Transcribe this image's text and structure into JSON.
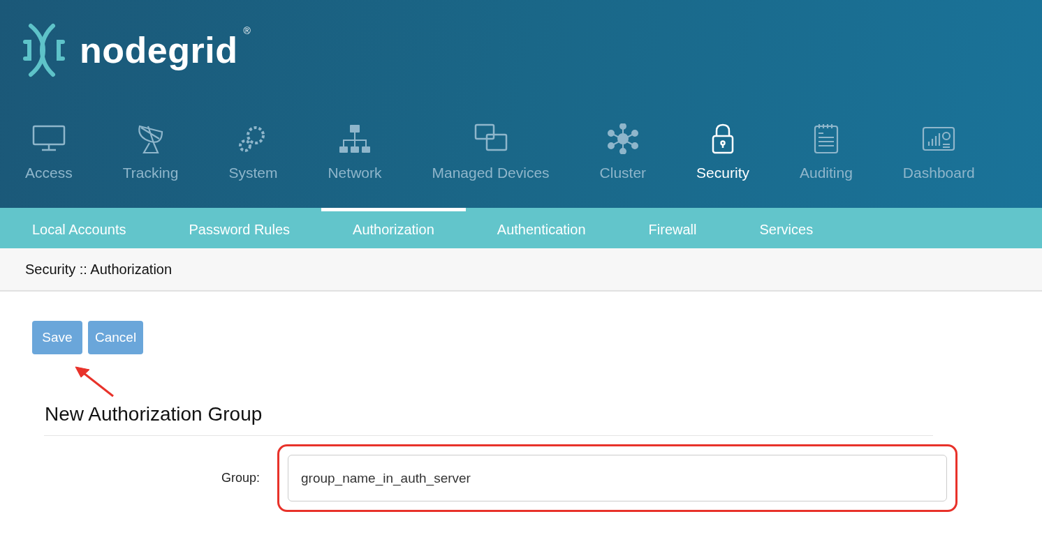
{
  "logo": {
    "wordmark": "nodegrid",
    "trademark": "®"
  },
  "main_nav": [
    {
      "label": "Access",
      "kind": "monitor",
      "selected": false
    },
    {
      "label": "Tracking",
      "kind": "dish",
      "selected": false
    },
    {
      "label": "System",
      "kind": "gears",
      "selected": false
    },
    {
      "label": "Network",
      "kind": "network",
      "selected": false
    },
    {
      "label": "Managed Devices",
      "kind": "windows",
      "selected": false
    },
    {
      "label": "Cluster",
      "kind": "cluster",
      "selected": false
    },
    {
      "label": "Security",
      "kind": "lock",
      "selected": true
    },
    {
      "label": "Auditing",
      "kind": "notepad",
      "selected": false
    },
    {
      "label": "Dashboard",
      "kind": "dashboard",
      "selected": false
    }
  ],
  "sub_nav": [
    {
      "label": "Local Accounts",
      "selected": false
    },
    {
      "label": "Password Rules",
      "selected": false
    },
    {
      "label": "Authorization",
      "selected": true
    },
    {
      "label": "Authentication",
      "selected": false
    },
    {
      "label": "Firewall",
      "selected": false
    },
    {
      "label": "Services",
      "selected": false
    }
  ],
  "breadcrumb": "Security :: Authorization",
  "buttons": [
    {
      "label": "Save"
    },
    {
      "label": "Cancel"
    }
  ],
  "annotation": {
    "arrow_to_save": true
  },
  "form": {
    "title": "New Authorization Group",
    "fields": [
      {
        "label": "Group:",
        "value": "group_name_in_auth_server",
        "highlighted": true
      }
    ]
  }
}
